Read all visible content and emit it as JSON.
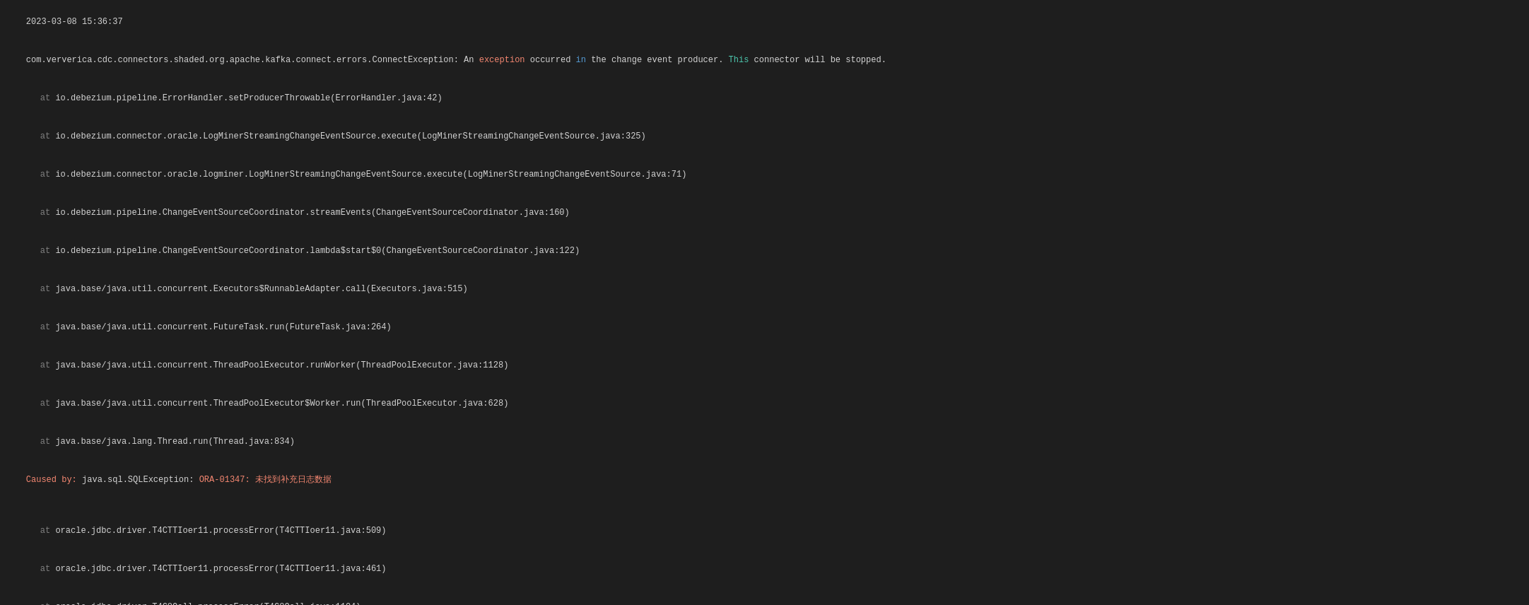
{
  "log": {
    "timestamp": "2023-03-08 15:36:37",
    "lines": []
  }
}
